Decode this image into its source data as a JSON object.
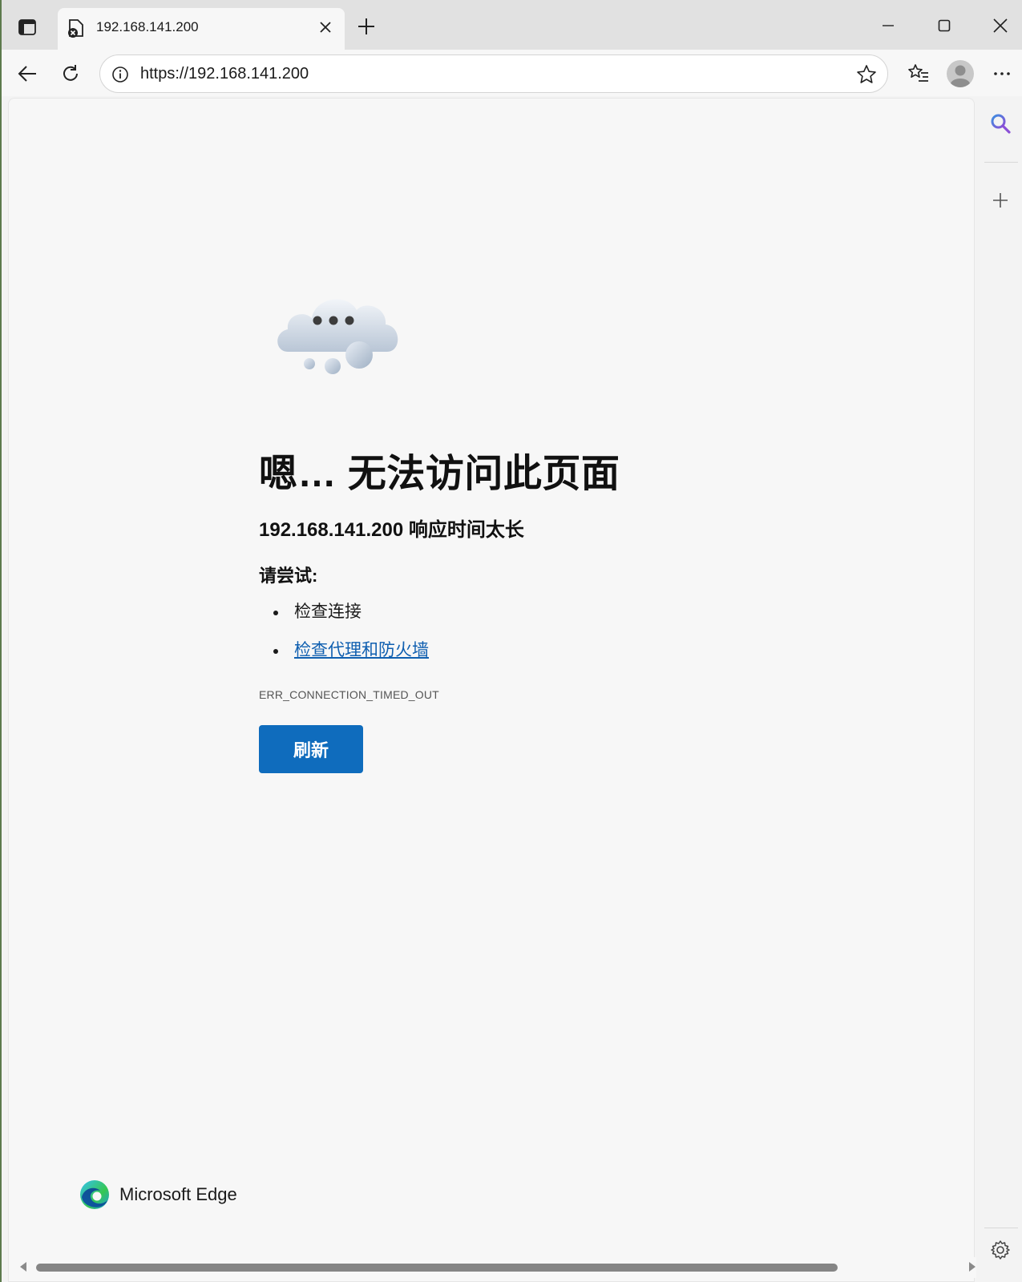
{
  "browser": {
    "tab": {
      "title": "192.168.141.200"
    },
    "address_bar": {
      "url": "https://192.168.141.200"
    }
  },
  "error_page": {
    "title": "嗯… 无法访问此页面",
    "subtitle": "192.168.141.200 响应时间太长",
    "try_label": "请尝试:",
    "suggestions": [
      {
        "label": "检查连接",
        "is_link": false
      },
      {
        "label": "检查代理和防火墙",
        "is_link": true
      }
    ],
    "error_code": "ERR_CONNECTION_TIMED_OUT",
    "refresh_label": "刷新"
  },
  "branding": {
    "name": "Microsoft Edge"
  },
  "colors": {
    "accent": "#0f6cbd",
    "link": "#0f5fb0",
    "page_bg": "#f7f7f7",
    "tabstrip_bg": "#e1e1e1"
  },
  "icons": [
    "tab-actions-icon",
    "error-favicon-icon",
    "close-icon",
    "plus-icon",
    "minimize-icon",
    "maximize-icon",
    "window-close-icon",
    "back-icon",
    "reload-icon",
    "info-icon",
    "star-icon",
    "favorites-icon",
    "profile-icon",
    "more-icon",
    "search-icon",
    "settings-icon",
    "cloud-icon",
    "edge-logo-icon"
  ]
}
